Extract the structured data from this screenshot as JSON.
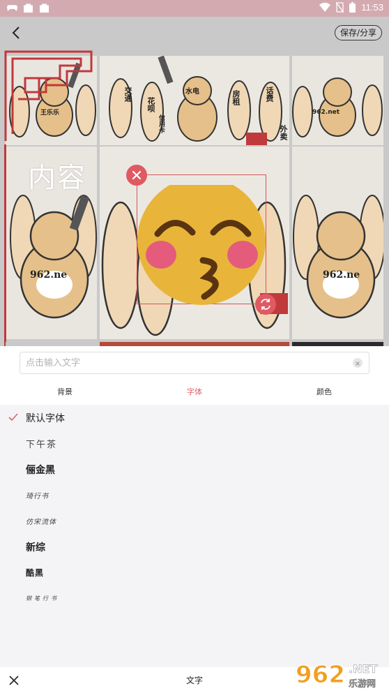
{
  "status_bar": {
    "time": "11:53",
    "left_icons": [
      "game-controller-icon",
      "bag-icon",
      "bag-icon"
    ],
    "right_icons": [
      "wifi-icon",
      "no-sim-icon",
      "battery-icon"
    ]
  },
  "editor": {
    "save_share_label": "保存/分享",
    "overlay_text": "内容",
    "meme_labels": {
      "bubble_1": "王乐乐",
      "bubble_2": "962.net",
      "domain": "962.ne",
      "tags": [
        "交通",
        "花呗",
        "水电",
        "房租",
        "话费",
        "信用卡",
        "外卖"
      ]
    }
  },
  "panel": {
    "input_placeholder": "点击输入文字",
    "input_value": "",
    "tabs": [
      {
        "label": "背景",
        "active": false
      },
      {
        "label": "字体",
        "active": true
      },
      {
        "label": "颜色",
        "active": false
      }
    ],
    "fonts": [
      {
        "label": "默认字体",
        "selected": true
      },
      {
        "label": "下午茶",
        "selected": false
      },
      {
        "label": "俪金黑",
        "selected": false
      },
      {
        "label": "琦行书",
        "selected": false
      },
      {
        "label": "仿宋流体",
        "selected": false
      },
      {
        "label": "新综",
        "selected": false
      },
      {
        "label": "酷黑",
        "selected": false
      },
      {
        "label": "钢笔行书",
        "selected": false
      }
    ]
  },
  "bottom_bar": {
    "title": "文字"
  },
  "watermark": {
    "brand": "962",
    "suffix": ".NET",
    "caption": "乐游网"
  },
  "colors": {
    "accent": "#e0606a",
    "status_bar": "#d4aab1",
    "frame_red": "#c0393b"
  }
}
